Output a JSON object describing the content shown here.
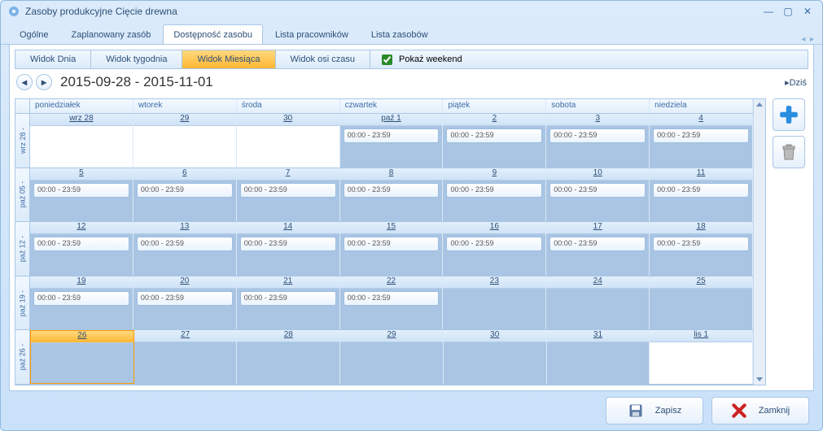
{
  "window": {
    "title": "Zasoby produkcyjne Cięcie drewna"
  },
  "main_tabs": {
    "items": [
      "Ogólne",
      "Zaplanowany zasób",
      "Dostępność zasobu",
      "Lista pracowników",
      "Lista zasobów"
    ],
    "active_index": 2
  },
  "view_tabs": {
    "items": [
      "Widok Dnia",
      "Widok tygodnia",
      "Widok Miesiąca",
      "Widok osi czasu"
    ],
    "active_index": 2,
    "show_weekend_label": "Pokaż weekend",
    "show_weekend_checked": true
  },
  "date_range": "2015-09-28 - 2015-11-01",
  "today_label": "Dziś",
  "day_headers": [
    "poniedziałek",
    "wtorek",
    "środa",
    "czwartek",
    "piątek",
    "sobota",
    "niedziela"
  ],
  "event_text": "00:00  -  23:59",
  "weeks": [
    {
      "label": "wrz 28 -",
      "days": [
        {
          "num": "wrz 28",
          "other": true,
          "event": false
        },
        {
          "num": "29",
          "other": true,
          "event": false
        },
        {
          "num": "30",
          "other": true,
          "event": false
        },
        {
          "num": "paź 1",
          "other": false,
          "event": true
        },
        {
          "num": "2",
          "other": false,
          "event": true
        },
        {
          "num": "3",
          "other": false,
          "event": true
        },
        {
          "num": "4",
          "other": false,
          "event": true
        }
      ]
    },
    {
      "label": "paź 05 -",
      "days": [
        {
          "num": "5",
          "other": false,
          "event": true
        },
        {
          "num": "6",
          "other": false,
          "event": true
        },
        {
          "num": "7",
          "other": false,
          "event": true
        },
        {
          "num": "8",
          "other": false,
          "event": true
        },
        {
          "num": "9",
          "other": false,
          "event": true
        },
        {
          "num": "10",
          "other": false,
          "event": true
        },
        {
          "num": "11",
          "other": false,
          "event": true
        }
      ]
    },
    {
      "label": "paź 12 -",
      "days": [
        {
          "num": "12",
          "other": false,
          "event": true
        },
        {
          "num": "13",
          "other": false,
          "event": true
        },
        {
          "num": "14",
          "other": false,
          "event": true
        },
        {
          "num": "15",
          "other": false,
          "event": true
        },
        {
          "num": "16",
          "other": false,
          "event": true
        },
        {
          "num": "17",
          "other": false,
          "event": true
        },
        {
          "num": "18",
          "other": false,
          "event": true
        }
      ]
    },
    {
      "label": "paź 19 -",
      "days": [
        {
          "num": "19",
          "other": false,
          "event": true
        },
        {
          "num": "20",
          "other": false,
          "event": true
        },
        {
          "num": "21",
          "other": false,
          "event": true
        },
        {
          "num": "22",
          "other": false,
          "event": true
        },
        {
          "num": "23",
          "other": false,
          "event": false
        },
        {
          "num": "24",
          "other": false,
          "event": false
        },
        {
          "num": "25",
          "other": false,
          "event": false
        }
      ]
    },
    {
      "label": "paź 26 -",
      "days": [
        {
          "num": "26",
          "other": false,
          "event": false,
          "today": true
        },
        {
          "num": "27",
          "other": false,
          "event": false
        },
        {
          "num": "28",
          "other": false,
          "event": false
        },
        {
          "num": "29",
          "other": false,
          "event": false
        },
        {
          "num": "30",
          "other": false,
          "event": false
        },
        {
          "num": "31",
          "other": false,
          "event": false
        },
        {
          "num": "lis 1",
          "other": true,
          "event": false
        }
      ]
    }
  ],
  "footer": {
    "save": "Zapisz",
    "close": "Zamknij"
  }
}
